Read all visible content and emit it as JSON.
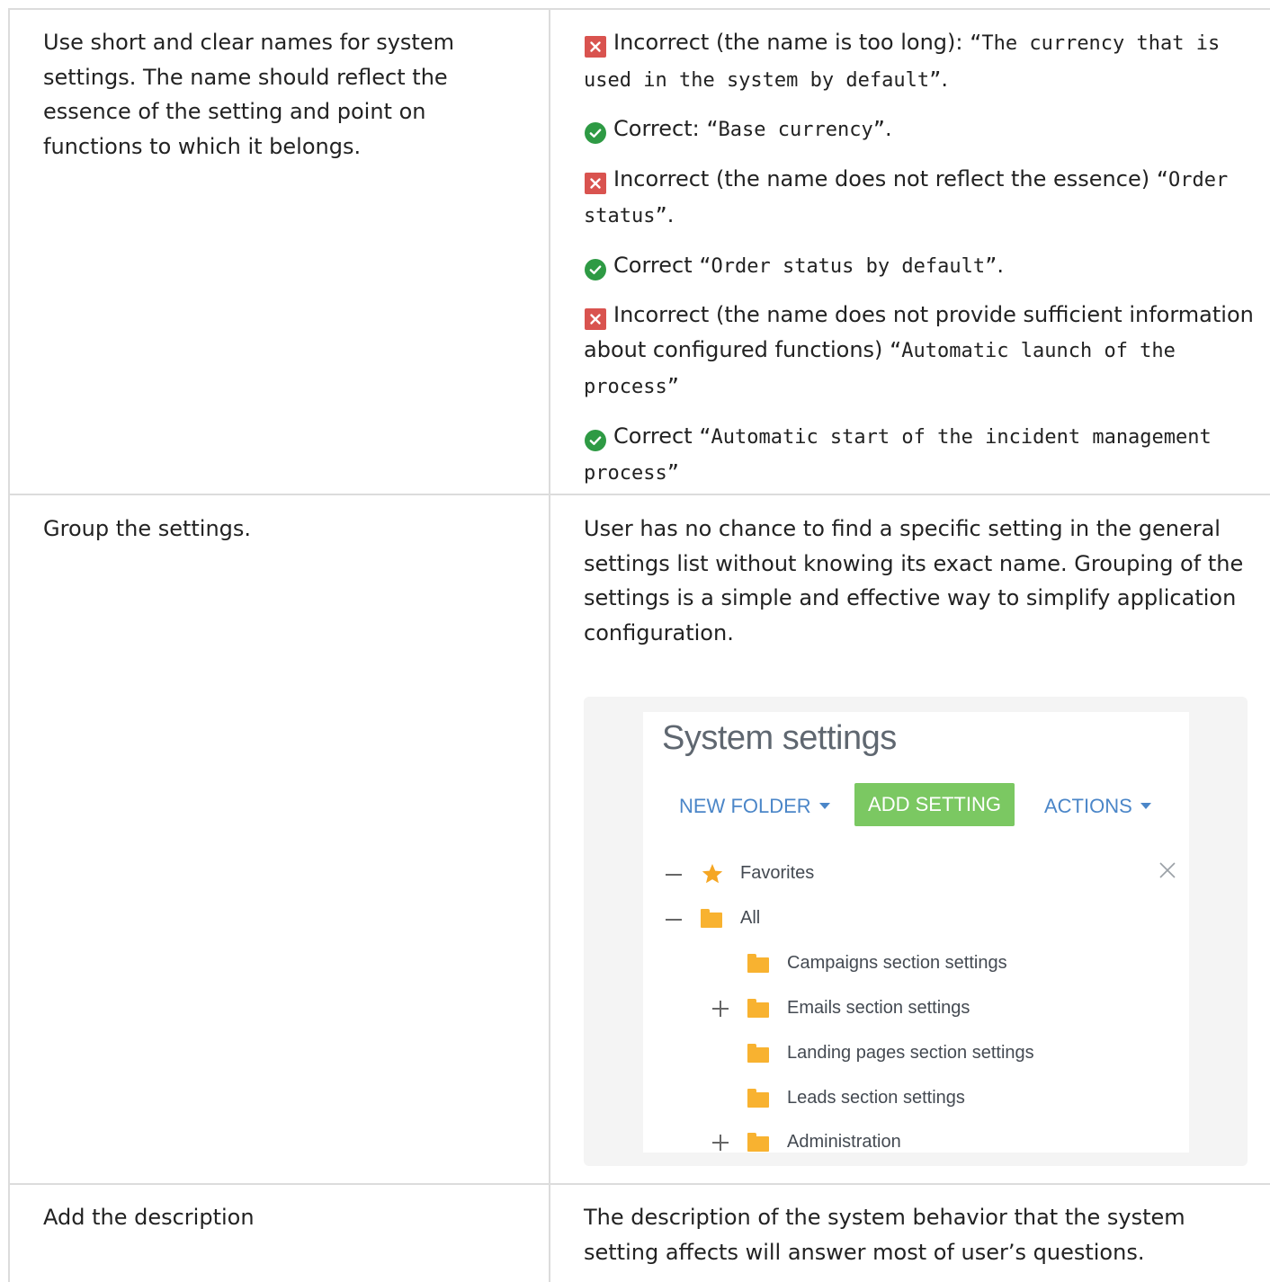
{
  "rows": [
    {
      "guideline": "Use short and clear names for system settings. The name should reflect the essence of the setting and point on functions to which it belongs.",
      "examples": [
        {
          "kind": "incorrect",
          "icon": "cross-icon",
          "label": "Incorrect (the name is too long): ",
          "value": "“The currency that is used in the system by default”",
          "suffix": "."
        },
        {
          "kind": "correct",
          "icon": "check-icon",
          "label": "Correct: ",
          "value": "“Base currency”",
          "suffix": "."
        },
        {
          "kind": "incorrect",
          "icon": "cross-icon",
          "label": "Incorrect (the name does not reflect the essence) ",
          "value": "“Order status”",
          "suffix": "."
        },
        {
          "kind": "correct",
          "icon": "check-icon",
          "label": "Correct ",
          "value": "“Order status by default”",
          "suffix": "."
        },
        {
          "kind": "incorrect",
          "icon": "cross-icon",
          "label": "Incorrect (the name does not provide sufficient information about configured functions) ",
          "value": "“Automatic launch of the process”",
          "suffix": ""
        },
        {
          "kind": "correct",
          "icon": "check-icon",
          "label": "Correct ",
          "value": "“Automatic start of the incident management process”",
          "suffix": ""
        }
      ]
    },
    {
      "guideline": "Group the settings.",
      "description": "User has no chance to find a specific setting in the general settings list without knowing its exact name. Grouping of the settings is a simple and effective way to simplify application configuration.",
      "screenshot": {
        "title": "System settings",
        "new_folder": "NEW FOLDER",
        "add_setting": "ADD SETTING",
        "actions": "ACTIONS",
        "tree": [
          {
            "label": "Favorites",
            "icon": "star-icon",
            "expander": "minus"
          },
          {
            "label": "All",
            "icon": "folder-icon",
            "expander": "minus"
          },
          {
            "label": "Campaigns section settings",
            "icon": "folder-icon",
            "expander": "none"
          },
          {
            "label": "Emails section settings",
            "icon": "folder-icon",
            "expander": "plus"
          },
          {
            "label": "Landing pages section settings",
            "icon": "folder-icon",
            "expander": "none"
          },
          {
            "label": "Leads section settings",
            "icon": "folder-icon",
            "expander": "none"
          },
          {
            "label": "Administration",
            "icon": "folder-icon",
            "expander": "plus"
          }
        ]
      }
    },
    {
      "guideline": "Add the description",
      "description": "The description of the system behavior that the system setting affects will answer most of user’s questions."
    }
  ],
  "colors": {
    "incorrect": "#d9534f",
    "correct": "#2e9a44",
    "accent": "#4b86c8",
    "button": "#7bc862",
    "folder": "#f8b230",
    "star": "#f5a623"
  }
}
